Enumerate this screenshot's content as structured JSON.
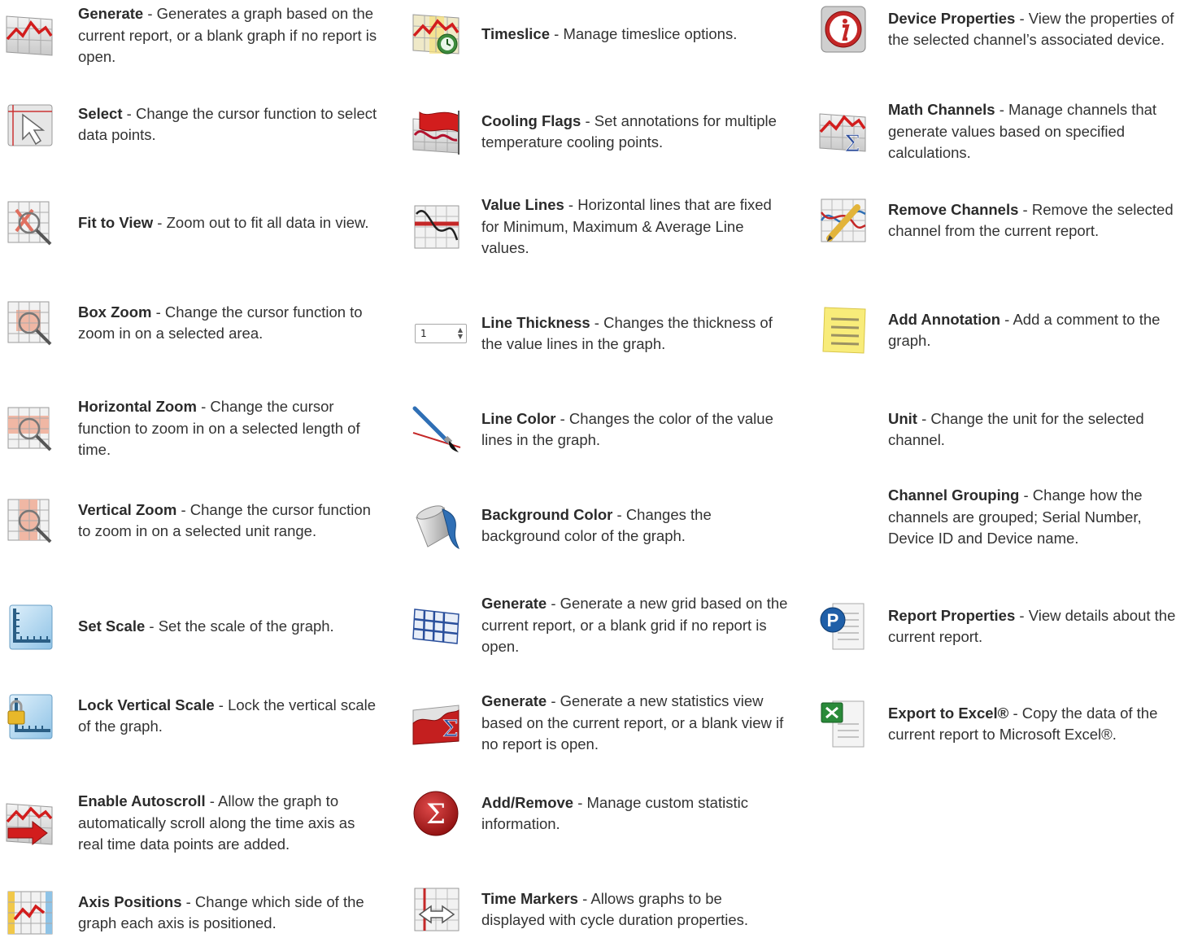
{
  "columns": [
    {
      "items": [
        {
          "title": "Generate",
          "desc": " - Generates a graph based on the current report, or a blank graph if no report is open.",
          "icon": "line-graph-icon"
        },
        {
          "title": "Select",
          "desc": " - Change the cursor function to select data points.",
          "icon": "select-cursor-icon"
        },
        {
          "title": "Fit to View",
          "desc": " - Zoom out to fit all data in view.",
          "icon": "fit-to-view-icon"
        },
        {
          "title": "Box Zoom",
          "desc": " - Change the cursor function to zoom in on a selected area.",
          "icon": "box-zoom-icon"
        },
        {
          "title": "Horizontal Zoom",
          "desc": " - Change the cursor function to zoom in on a selected length of time.",
          "icon": "horizontal-zoom-icon"
        },
        {
          "title": "Vertical Zoom",
          "desc": " - Change the cursor function to zoom in on a selected unit range.",
          "icon": "vertical-zoom-icon"
        },
        {
          "title": "Set Scale",
          "desc": " - Set the scale of the graph.",
          "icon": "set-scale-icon"
        },
        {
          "title": "Lock Vertical Scale",
          "desc": " - Lock the vertical scale of the graph.",
          "icon": "lock-scale-icon"
        },
        {
          "title": "Enable Autoscroll",
          "desc": " - Allow the graph to automatically scroll along the time axis as real time data points are added.",
          "icon": "autoscroll-icon"
        },
        {
          "title": "Axis Positions",
          "desc": " - Change which side of the graph each axis is positioned.",
          "icon": "axis-positions-icon"
        }
      ]
    },
    {
      "items": [
        {
          "title": "Timeslice",
          "desc": " - Manage timeslice options.",
          "icon": "timeslice-icon"
        },
        {
          "title": "Cooling Flags",
          "desc": " - Set annotations for multiple temperature cooling points.",
          "icon": "cooling-flag-icon"
        },
        {
          "title": "Value Lines",
          "desc": " - Horizontal lines that are fixed for Minimum, Maximum & Average Line values.",
          "icon": "value-lines-icon"
        },
        {
          "title": "Line Thickness",
          "desc": " - Changes the thickness of the value lines in the graph.",
          "icon": "line-thickness-stepper",
          "stepper_value": "1"
        },
        {
          "title": "Line Color",
          "desc": " - Changes the color of the value lines in the graph.",
          "icon": "paintbrush-icon"
        },
        {
          "title": "Background Color",
          "desc": " - Changes the background color of the graph.",
          "icon": "paint-bucket-icon"
        },
        {
          "title": "Generate",
          "desc": " - Generate a new grid based on the current report, or a blank grid if no report is open.",
          "icon": "grid-icon"
        },
        {
          "title": "Generate",
          "desc": " - Generate a new statistics view based on the current report, or a blank view if no report is open.",
          "icon": "statistics-icon"
        },
        {
          "title": "Add/Remove",
          "desc": " - Manage custom statistic information.",
          "icon": "sigma-circle-icon"
        },
        {
          "title": "Time Markers",
          "desc": " - Allows graphs to be displayed with cycle duration properties.",
          "icon": "time-markers-icon"
        }
      ]
    },
    {
      "items": [
        {
          "title": "Device Properties",
          "desc": " - View the properties of the selected channel’s associated device.",
          "icon": "device-info-icon"
        },
        {
          "title": "Math Channels",
          "desc": " - Manage channels that generate values based on specified calculations.",
          "icon": "math-channels-icon"
        },
        {
          "title": "Remove Channels",
          "desc": " - Remove the selected channel from the current report.",
          "icon": "remove-channels-icon"
        },
        {
          "title": "Add Annotation",
          "desc": " - Add a comment to the graph.",
          "icon": "sticky-note-icon"
        },
        {
          "title": "Unit",
          "desc": " - Change the unit for the selected channel.",
          "icon": ""
        },
        {
          "title": "Channel Grouping",
          "desc": " - Change how the channels are grouped; Serial Number, Device ID and Device name.",
          "icon": ""
        },
        {
          "title": "Report Properties",
          "desc": " - View details about the current report.",
          "icon": "report-properties-icon"
        },
        {
          "title": "Export to Excel®",
          "desc": " - Copy the data of the current report to Microsoft Excel®.",
          "icon": "excel-export-icon"
        }
      ]
    }
  ]
}
